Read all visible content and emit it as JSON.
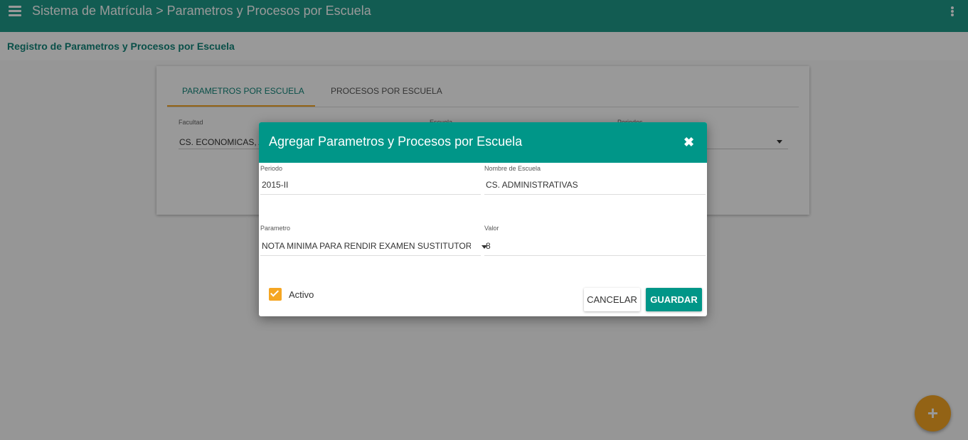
{
  "appbar": {
    "title": "Sistema de Matrícula > Parametros y Procesos por Escuela"
  },
  "subheader": {
    "title": "Registro de Parametros y Procesos por Escuela"
  },
  "card": {
    "tabs": [
      {
        "label": "PARAMETROS POR ESCUELA",
        "active": true
      },
      {
        "label": "PROCESOS POR ESCUELA",
        "active": false
      }
    ],
    "fields": {
      "facultad_label": "Facultad",
      "facultad_value": "CS. ECONOMICAS, A",
      "escuela_label": "Escuela",
      "periodos_label": "Periodos"
    }
  },
  "dialog": {
    "title": "Agregar Parametros y Procesos por Escuela",
    "periodo_label": "Periodo",
    "periodo_value": "2015-II",
    "escuela_label": "Nombre de Escuela",
    "escuela_value": "CS. ADMINISTRATIVAS",
    "parametro_label": "Parametro",
    "parametro_value": "NOTA MINIMA PARA RENDIR EXAMEN SUSTITUTORIO",
    "valor_label": "Valor",
    "valor_value": "8",
    "activo_label": "Activo",
    "activo_checked": true,
    "cancel_label": "CANCELAR",
    "save_label": "GUARDAR"
  },
  "fab": {
    "symbol": "+"
  },
  "colors": {
    "primary": "#009688",
    "accent": "#f5a623"
  }
}
